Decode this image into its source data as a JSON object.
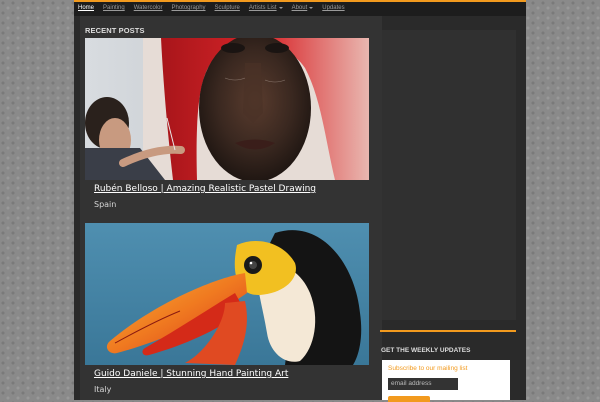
{
  "nav": {
    "items": [
      {
        "label": "Home",
        "active": true
      },
      {
        "label": "Painting",
        "active": false
      },
      {
        "label": "Watercolor",
        "active": false
      },
      {
        "label": "Photography",
        "active": false
      },
      {
        "label": "Sculpture",
        "active": false
      },
      {
        "label": "Artists List",
        "active": false,
        "has_dropdown": true
      },
      {
        "label": "About",
        "active": false,
        "has_dropdown": true
      },
      {
        "label": "Updates",
        "active": false
      }
    ]
  },
  "main": {
    "section_title": "RECENT POSTS",
    "posts": [
      {
        "title": "Rubén Belloso | Amazing Realistic Pastel Drawing",
        "meta": "Spain",
        "image": "pastel-portrait-drawing-image"
      },
      {
        "title": "Guido Daniele | Stunning Hand Painting Art",
        "meta": "Italy",
        "image": "toucan-hand-painting-image"
      }
    ]
  },
  "sidebar": {
    "widget_title": "GET THE WEEKLY UPDATES",
    "subscribe_label": "Subscribe to our mailing list",
    "email_placeholder": "email address",
    "submit_label": ""
  },
  "colors": {
    "accent": "#f29a1e",
    "page_bg": "#2a2a2a",
    "content_bg": "#333333"
  }
}
